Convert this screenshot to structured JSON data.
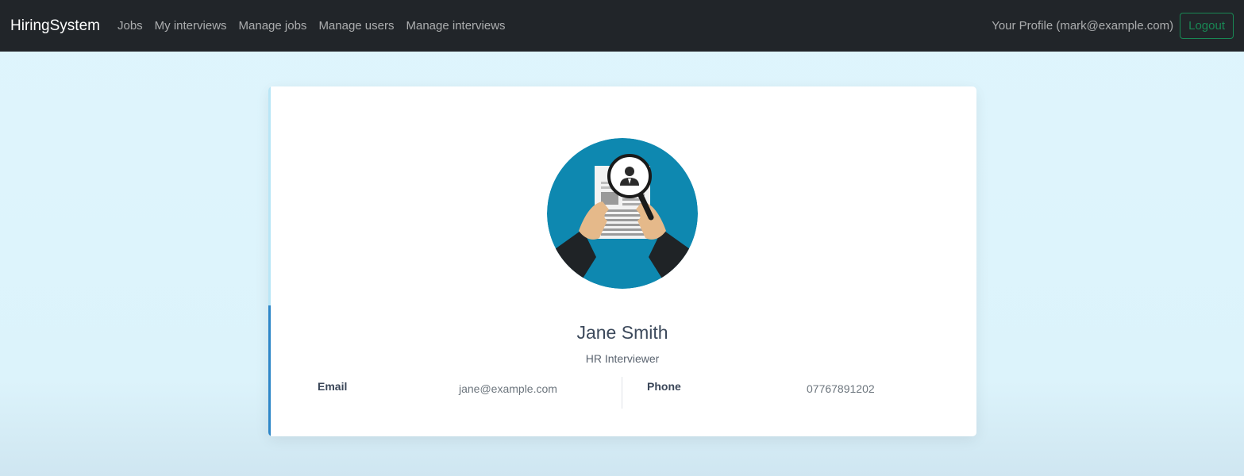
{
  "navbar": {
    "brand": "HiringSystem",
    "links": [
      "Jobs",
      "My interviews",
      "Manage jobs",
      "Manage users",
      "Manage interviews"
    ],
    "profile": "Your Profile (mark@example.com)",
    "logout": "Logout"
  },
  "profile_card": {
    "name": "Jane Smith",
    "role": "HR Interviewer",
    "email_label": "Email",
    "email_value": "jane@example.com",
    "phone_label": "Phone",
    "phone_value": "07767891202",
    "avatar_icon": "resume-search-icon"
  },
  "colors": {
    "navbar_bg": "#212529",
    "logout_accent": "#198754",
    "avatar_bg": "#0e88b0",
    "card_accent": "#2d86c8"
  }
}
